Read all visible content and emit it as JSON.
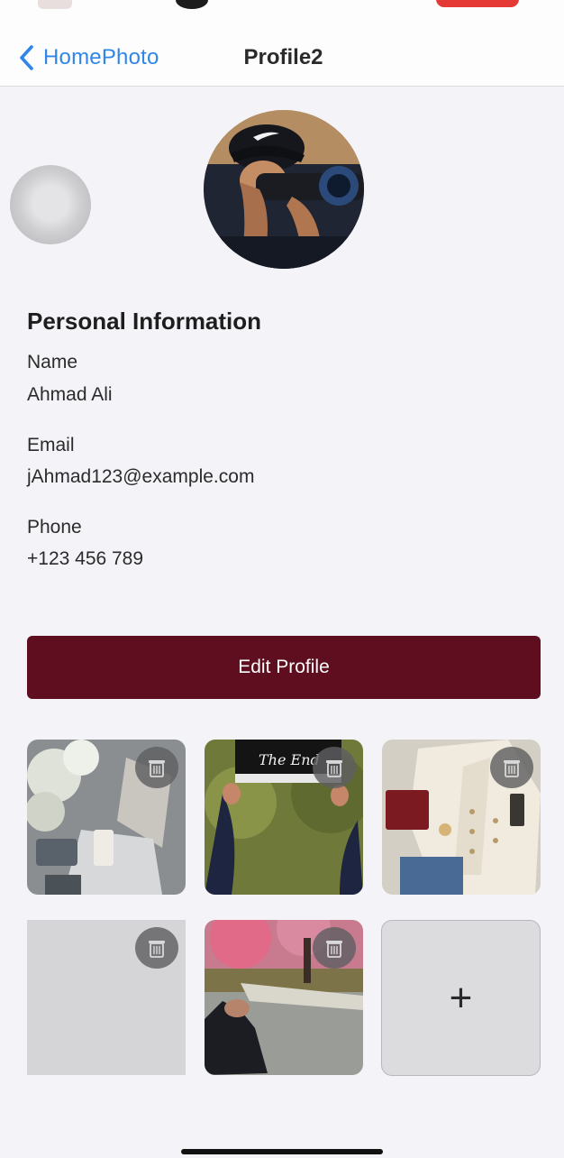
{
  "nav": {
    "back_label": "HomePhoto",
    "title": "Profile2"
  },
  "personal_info": {
    "section_title": "Personal Information",
    "name_label": "Name",
    "name_value": "Ahmad Ali",
    "email_label": "Email",
    "email_value": "jAhmad123@example.com",
    "phone_label": "Phone",
    "phone_value": "+123 456 789"
  },
  "edit_button_label": "Edit Profile",
  "gallery": {
    "add_label": "+",
    "photo2_clapper_text": "The End"
  },
  "colors": {
    "accent": "#2f86e6",
    "edit_button": "#5e0e1e",
    "background": "#f4f3f8"
  },
  "icons": {
    "back": "chevron-left-icon",
    "delete": "trash-icon",
    "add": "plus-icon"
  }
}
